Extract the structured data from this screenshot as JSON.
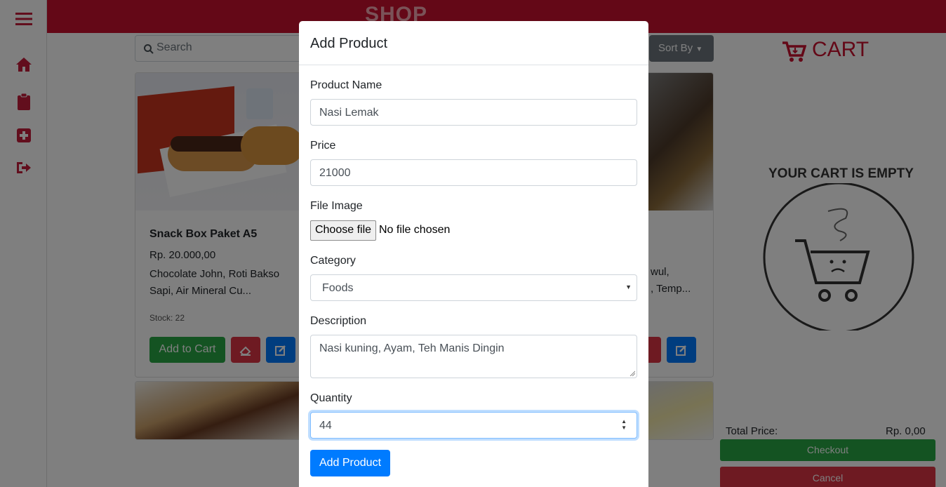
{
  "header": {
    "title": "SHOP"
  },
  "toolbar": {
    "search_placeholder": "Search",
    "sort_label": "Sort By"
  },
  "products": [
    {
      "name": "Snack Box Paket A5",
      "price": "Rp. 20.000,00",
      "description": "Chocolate John, Roti Bakso Sapi, Air Mineral Cu...",
      "stock": "Stock: 22",
      "add_label": "Add to Cart"
    },
    {
      "description_fragment_1": "wul,",
      "description_fragment_2": ", Temp..."
    }
  ],
  "cart": {
    "title": "CART",
    "empty_message": "YOUR CART IS EMPTY",
    "total_label": "Total Price:",
    "total_value": "Rp. 0,00",
    "checkout_label": "Checkout",
    "cancel_label": "Cancel"
  },
  "modal": {
    "title": "Add Product",
    "fields": {
      "name_label": "Product Name",
      "name_value": "Nasi Lemak",
      "price_label": "Price",
      "price_value": "21000",
      "file_label": "File Image",
      "file_button": "Choose file",
      "file_status": "No file chosen",
      "category_label": "Category",
      "category_value": "Foods",
      "description_label": "Description",
      "description_value": "Nasi kuning, Ayam, Teh Manis Dingin",
      "quantity_label": "Quantity",
      "quantity_value": "44"
    },
    "submit_label": "Add Product"
  },
  "colors": {
    "brand": "#c8102e",
    "primary": "#007bff",
    "success": "#28a745",
    "danger": "#dc3545",
    "secondary": "#6c757d"
  }
}
